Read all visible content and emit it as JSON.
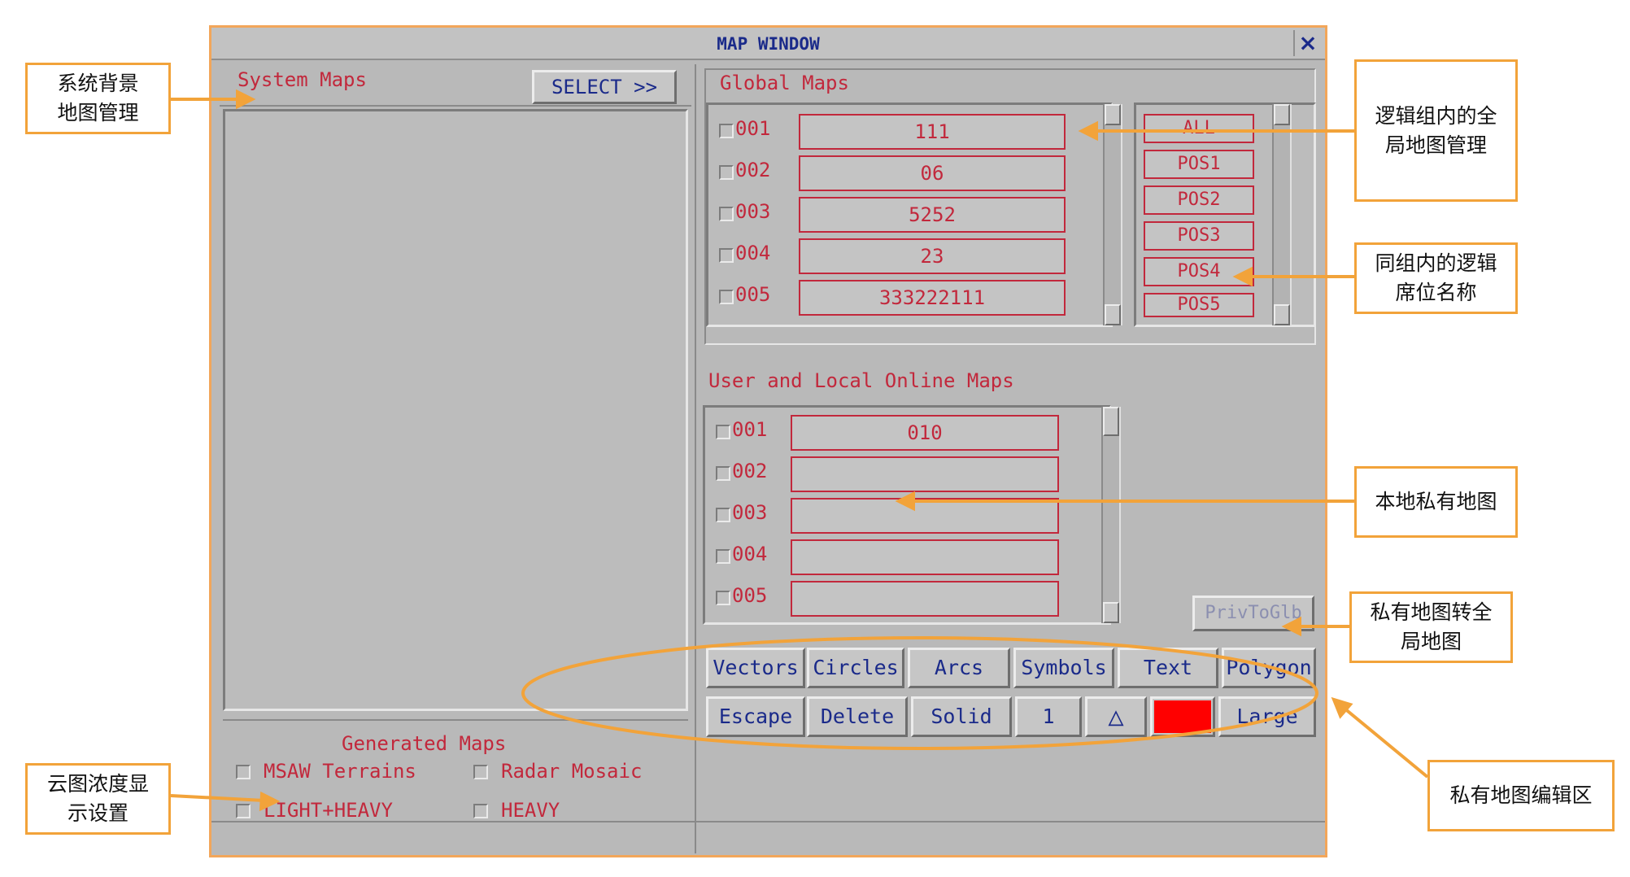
{
  "window": {
    "title": "MAP WINDOW",
    "close": "×"
  },
  "system_maps": {
    "label": "System Maps",
    "select_button": "SELECT >>"
  },
  "generated_maps": {
    "label": "Generated Maps",
    "options": [
      "MSAW Terrains",
      "Radar Mosaic",
      "LIGHT+HEAVY",
      "HEAVY"
    ]
  },
  "global_maps": {
    "label": "Global Maps",
    "rows": [
      {
        "id": "001",
        "value": "111"
      },
      {
        "id": "002",
        "value": "06"
      },
      {
        "id": "003",
        "value": "5252"
      },
      {
        "id": "004",
        "value": "23"
      },
      {
        "id": "005",
        "value": "333222111"
      }
    ],
    "positions": [
      "ALL",
      "POS1",
      "POS2",
      "POS3",
      "POS4",
      "POS5"
    ]
  },
  "local_maps": {
    "label": "User and Local Online Maps",
    "rows": [
      {
        "id": "001",
        "value": "010"
      },
      {
        "id": "002",
        "value": ""
      },
      {
        "id": "003",
        "value": ""
      },
      {
        "id": "004",
        "value": ""
      },
      {
        "id": "005",
        "value": ""
      }
    ],
    "priv_to_glb": "PrivToGlb"
  },
  "toolbar": {
    "row1": [
      "Vectors",
      "Circles",
      "Arcs",
      "Symbols",
      "Text",
      "Polygon"
    ],
    "row2": [
      "Escape",
      "Delete",
      "Solid",
      "1",
      "△",
      "",
      "Large"
    ],
    "color_swatch": "#ff0000"
  },
  "callouts": {
    "system_bg": "系统背景\n地图管理",
    "cloud": "云图浓度显\n示设置",
    "global_mgmt": "逻辑组内的全\n局地图管理",
    "positions": "同组内的逻辑\n席位名称",
    "local_private": "本地私有地图",
    "priv_to_global": "私有地图转全\n局地图",
    "edit_area": "私有地图编辑区"
  },
  "colors": {
    "accent_orange": "#f2a33a",
    "field_red": "#c2283c",
    "label_blue": "#1a2a8a"
  }
}
